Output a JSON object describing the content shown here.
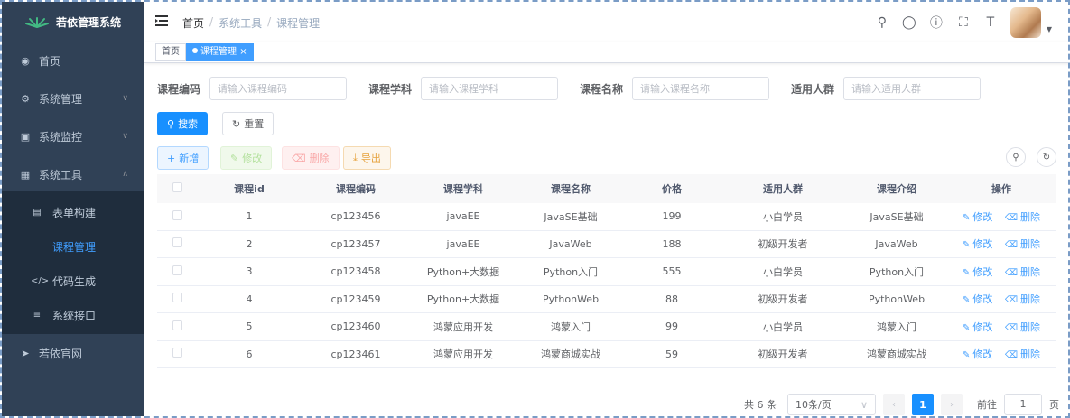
{
  "app": {
    "title": "若依管理系统"
  },
  "sidebar": {
    "items": [
      {
        "label": "首页",
        "icon": "dashboard-icon"
      },
      {
        "label": "系统管理",
        "icon": "gear-icon"
      },
      {
        "label": "系统监控",
        "icon": "monitor-icon"
      },
      {
        "label": "系统工具",
        "icon": "toolbox-icon"
      },
      {
        "label": "若依官网",
        "icon": "send-icon"
      }
    ],
    "sub_items": [
      {
        "label": "表单构建",
        "icon": "build-icon"
      },
      {
        "label": "课程管理",
        "icon": ""
      },
      {
        "label": "代码生成",
        "icon": "code-icon"
      },
      {
        "label": "系统接口",
        "icon": "api-icon"
      }
    ]
  },
  "navbar": {
    "breadcrumb": [
      "首页",
      "系统工具",
      "课程管理"
    ]
  },
  "tags": [
    {
      "label": "首页",
      "active": false
    },
    {
      "label": "课程管理",
      "active": true
    }
  ],
  "search": {
    "fields": [
      {
        "label": "课程编码",
        "placeholder": "请输入课程编码"
      },
      {
        "label": "课程学科",
        "placeholder": "请输入课程学科"
      },
      {
        "label": "课程名称",
        "placeholder": "请输入课程名称"
      },
      {
        "label": "适用人群",
        "placeholder": "请输入适用人群"
      }
    ],
    "search_label": "搜索",
    "reset_label": "重置"
  },
  "toolbar": {
    "add_label": "新增",
    "edit_label": "修改",
    "delete_label": "删除",
    "export_label": "导出"
  },
  "table": {
    "headers": [
      "课程id",
      "课程编码",
      "课程学科",
      "课程名称",
      "价格",
      "适用人群",
      "课程介绍",
      "操作"
    ],
    "rows": [
      [
        "1",
        "cp123456",
        "javaEE",
        "JavaSE基础",
        "199",
        "小白学员",
        "JavaSE基础"
      ],
      [
        "2",
        "cp123457",
        "javaEE",
        "JavaWeb",
        "188",
        "初级开发者",
        "JavaWeb"
      ],
      [
        "3",
        "cp123458",
        "Python+大数据",
        "Python入门",
        "555",
        "小白学员",
        "Python入门"
      ],
      [
        "4",
        "cp123459",
        "Python+大数据",
        "PythonWeb",
        "88",
        "初级开发者",
        "PythonWeb"
      ],
      [
        "5",
        "cp123460",
        "鸿蒙应用开发",
        "鸿蒙入门",
        "99",
        "小白学员",
        "鸿蒙入门"
      ],
      [
        "6",
        "cp123461",
        "鸿蒙应用开发",
        "鸿蒙商城实战",
        "59",
        "初级开发者",
        "鸿蒙商城实战"
      ]
    ],
    "op_edit": "修改",
    "op_delete": "删除"
  },
  "pagination": {
    "total_text": "共 6 条",
    "page_size": "10条/页",
    "current_page": "1",
    "goto_label": "前往",
    "goto_value": "1",
    "page_unit": "页"
  },
  "colors": {
    "sidebar_bg": "#304156",
    "primary": "#1890ff",
    "active_menu": "#409eff"
  }
}
